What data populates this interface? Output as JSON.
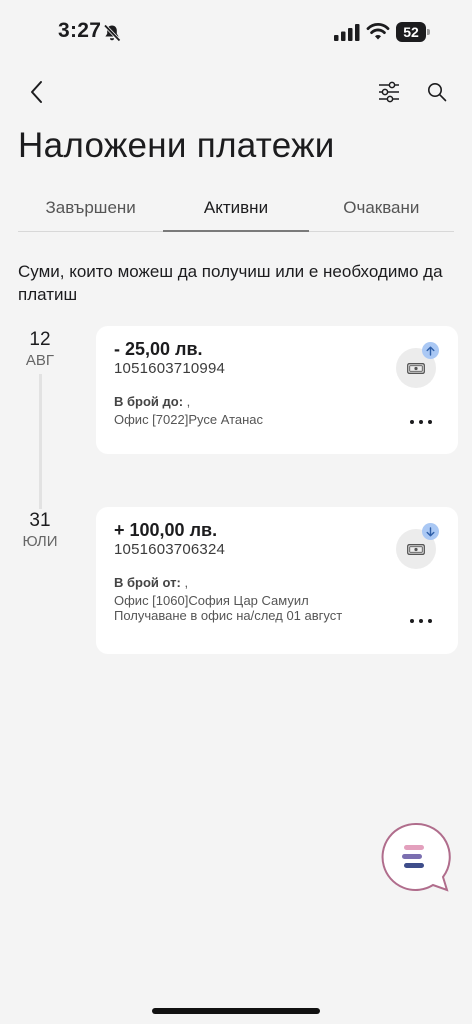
{
  "status_bar": {
    "time": "3:27",
    "battery": "52"
  },
  "page": {
    "title": "Наложени платежи"
  },
  "tabs": [
    {
      "label": "Завършени",
      "active": false
    },
    {
      "label": "Активни",
      "active": true
    },
    {
      "label": "Очаквани",
      "active": false
    }
  ],
  "description": "Суми, които можеш да получиш или е необходимо да платиш",
  "payments": [
    {
      "day": "12",
      "month": "АВГ",
      "amount": "- 25,00 лв.",
      "number": "1051603710994",
      "label": "В брой до:",
      "label_suffix": " ,",
      "office": "Офис [7022]Русе Атанас",
      "note": "",
      "direction": "outgoing"
    },
    {
      "day": "31",
      "month": "ЮЛИ",
      "amount": "+ 100,00 лв.",
      "number": "1051603706324",
      "label": "В брой от:",
      "label_suffix": " ,",
      "office": "Офис [1060]София Цар Самуил",
      "note": "Получаване в офис на/след 01 август",
      "direction": "incoming"
    }
  ],
  "colors": {
    "accent_blue": "#aac8f4",
    "chat_pink": "#e3a0bd",
    "chat_purple": "#7b6fb0",
    "chat_navy": "#3e4d8a"
  }
}
